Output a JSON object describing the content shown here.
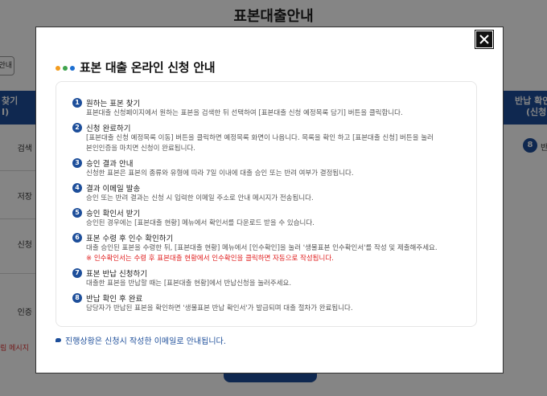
{
  "background": {
    "page_title": "표본대출안내",
    "small_button_label": "안내",
    "left_column": {
      "header": [
        "찾기",
        "I)"
      ],
      "cells": [
        "검색",
        "저장",
        "신청",
        "인증"
      ],
      "message": "림 메시지"
    },
    "right_column": {
      "header": [
        "반납 확인",
        "(신청"
      ],
      "step_number": "8",
      "step_text": "반"
    }
  },
  "modal": {
    "title": "표본 대출 온라인 신청 안내",
    "dot_colors": [
      "#f39c1f",
      "#3fa34d",
      "#1d6fd1"
    ],
    "accent_color": "#1d4e9a",
    "note_color": "#e02020",
    "steps": [
      {
        "num": "1",
        "title": "원하는 표본 찾기",
        "desc": "표본대출 신청페이지에서 원하는 표본을 검색한 뒤 선택하여 [표본대출 신청 예정목록 담기] 버튼을 클릭합니다."
      },
      {
        "num": "2",
        "title": "신청 완료하기",
        "desc": "[표본대출 신청 예정목록 이동] 버튼을 클릭하면 예정목록 화면이 나옵니다. 목록을 확인 하고 [표본대출 신청] 버튼을 눌러",
        "desc2": "본인인증을 마치면 신청이 완료됩니다."
      },
      {
        "num": "3",
        "title": "승인 결과 안내",
        "desc": "신청한 표본은 표본의 종류와 유형에 따라 7일 이내에 대출 승인 또는 반려 여부가 결정됩니다."
      },
      {
        "num": "4",
        "title": "결과 이메일 발송",
        "desc": "승인 또는 반려 결과는 신청 시 입력한 이메일 주소로 안내 메시지가 전송됩니다."
      },
      {
        "num": "5",
        "title": "승인 확인서 받기",
        "desc": "승인된 경우에는 [표본대출 현황] 메뉴에서 확인서를 다운로드 받을 수 있습니다."
      },
      {
        "num": "6",
        "title": "표본 수령 후 인수 확인하기",
        "desc": "대출 승인된 표본을 수령한 뒤, [표본대출 현황] 메뉴에서 [인수확인]을 눌러 '생물표본 인수확인서'를 작성 및 제출해주세요.",
        "note": "※ 인수확인서는 수령 후 표본대출 현황에서 인수확인을 클릭하면 자동으로 작성됩니다."
      },
      {
        "num": "7",
        "title": "표본 반납 신청하기",
        "desc": "대출한 표본을 반납할 때는 [표본대출 현황]에서 반납신청을 눌러주세요."
      },
      {
        "num": "8",
        "title": "반납 확인 후 완료",
        "desc": "담당자가 반납된 표본을 확인하면 '생물표본 반납 확인서'가 발급되며 대출 절차가 완료됩니다."
      }
    ],
    "footer": "진행상황은 신청시 작성한 이메일로 안내됩니다."
  }
}
